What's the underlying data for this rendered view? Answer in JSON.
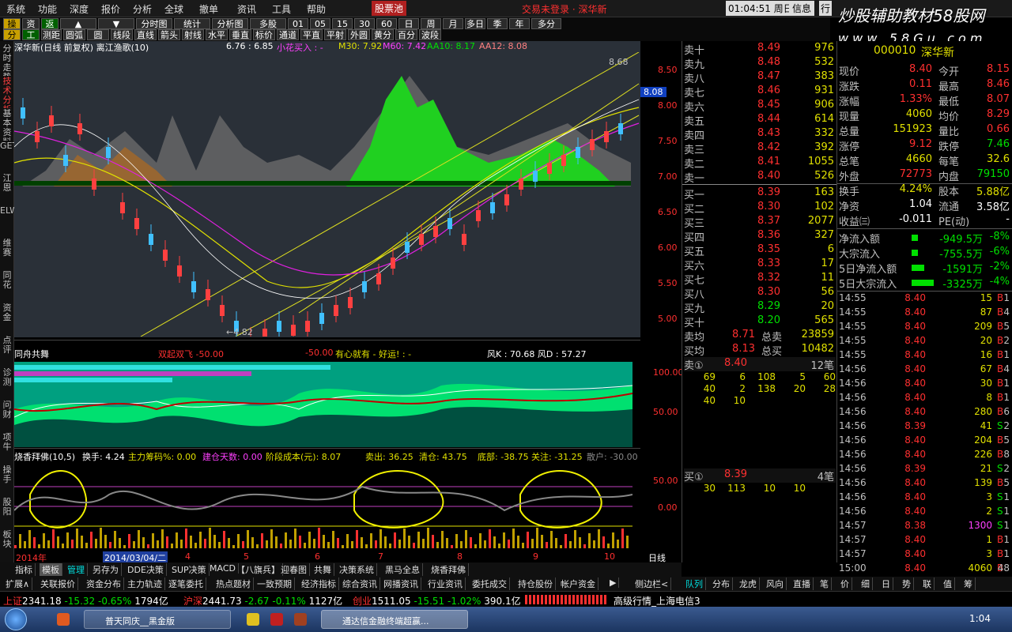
{
  "menu": [
    "系统",
    "功能",
    "深度",
    "报价",
    "分析",
    "全球",
    "撤单",
    "资讯",
    "工具",
    "帮助",
    "股票池"
  ],
  "menu_right": {
    "time": "01:04:51",
    "day": "周日",
    "btn1": "信息",
    "btn2": "行"
  },
  "menu_alert": "交易未登录 · 深华新",
  "watermark": {
    "line1": "炒股辅助教材58股网",
    "line2": "w w w . 5 8 G u . c o m"
  },
  "toolbar": {
    "row1": [
      "操盘",
      "资讯",
      "返回",
      "▲",
      "▼",
      "分时图",
      "统计",
      "分析图",
      "多股",
      "01",
      "05",
      "15",
      "30",
      "60",
      "日",
      "周",
      "月",
      "多日",
      "季",
      "年",
      "多分"
    ],
    "row2": [
      "分析",
      "工具",
      "测距",
      "圆弧",
      "圆",
      "线段",
      "直线",
      "箭头",
      "射线",
      "水平",
      "垂直",
      "标价",
      "通道",
      "平直",
      "平射",
      "外圆",
      "黄分",
      "百分",
      "波段"
    ]
  },
  "left_tabs": [
    "分时走势",
    "技术分析",
    "基本资料",
    "GET",
    "江恩",
    "ELWAVE",
    "维赛",
    "同花",
    "资金",
    "点评",
    "诊测",
    "问财",
    "项牛",
    "操手",
    "股阳",
    "板块"
  ],
  "chart_header": {
    "title": "深华新(日线 前复权) 离江渔歌(10)",
    "vals": "6.76 : 6.85",
    "signal": "小花买入 : -",
    "m30": "M30: 7.92",
    "m60": "M60: 7.42",
    "aa10": "AA10: 8.17",
    "aa12": "AA12: 8.08"
  },
  "axis_main": [
    "8.50",
    "8.00",
    "7.50",
    "7.00",
    "6.50",
    "6.00",
    "5.50",
    "5.00"
  ],
  "price_tag": "8.08",
  "high_label": "8.68",
  "low_label": "←4.82",
  "ind1": {
    "title": "同舟共舞",
    "a": "双起双飞 -50.00",
    "b": "-50.00",
    "c": "有心就有 - 好运! : -",
    "d": "风K : 70.68  风D : 57.27",
    "axis": [
      "100.00",
      "50.00"
    ]
  },
  "ind2": {
    "title": "烧香拜佛(10,5)",
    "a": "换手: 4.24",
    "b": "主力筹码%: 0.00",
    "c": "建仓天数: 0.00",
    "d": "阶段成本(元): 8.07",
    "e": "卖出: 36.25",
    "f": "清仓: 43.75",
    "g": "底部: -38.75",
    "h": "关注: -31.25",
    "i": "散户: -30.00",
    "axis": [
      "50.00",
      "0.00"
    ]
  },
  "xaxis": {
    "year": "2014年",
    "date": "2014/03/04/二",
    "months": [
      "4",
      "5",
      "6",
      "7",
      "8",
      "9",
      "10"
    ],
    "period": "日线"
  },
  "book": {
    "sells": [
      [
        "卖十",
        "8.49",
        "976"
      ],
      [
        "卖九",
        "8.48",
        "532"
      ],
      [
        "卖八",
        "8.47",
        "383"
      ],
      [
        "卖七",
        "8.46",
        "931"
      ],
      [
        "卖六",
        "8.45",
        "906"
      ],
      [
        "卖五",
        "8.44",
        "614"
      ],
      [
        "卖四",
        "8.43",
        "332"
      ],
      [
        "卖三",
        "8.42",
        "392"
      ],
      [
        "卖二",
        "8.41",
        "1055"
      ],
      [
        "卖一",
        "8.40",
        "526"
      ]
    ],
    "buys": [
      [
        "买一",
        "8.39",
        "163"
      ],
      [
        "买二",
        "8.30",
        "102"
      ],
      [
        "买三",
        "8.37",
        "2077"
      ],
      [
        "买四",
        "8.36",
        "327"
      ],
      [
        "买五",
        "8.35",
        "6"
      ],
      [
        "买六",
        "8.33",
        "17"
      ],
      [
        "买七",
        "8.32",
        "11"
      ],
      [
        "买八",
        "8.30",
        "56"
      ],
      [
        "买九",
        "8.29",
        "20"
      ],
      [
        "买十",
        "8.20",
        "565"
      ]
    ],
    "avg_sell": [
      "卖均",
      "8.71",
      "总卖",
      "23859"
    ],
    "avg_buy": [
      "买均",
      "8.13",
      "总买",
      "10482"
    ],
    "sell1": {
      "label": "卖①",
      "price": "8.40",
      "count": "12笔",
      "rows": [
        [
          "69",
          "6",
          "108",
          "5",
          "60"
        ],
        [
          "40",
          "2",
          "138",
          "20",
          "28"
        ],
        [
          "40",
          "10",
          "",
          "",
          ""
        ]
      ]
    },
    "buy1": {
      "label": "买①",
      "price": "8.39",
      "count": "4笔",
      "rows": [
        [
          "30",
          "113",
          "10",
          "10",
          ""
        ]
      ]
    }
  },
  "quote": {
    "code": "000010",
    "name": "深华新",
    "rows": [
      [
        "现价",
        "8.40",
        "今开",
        "8.15"
      ],
      [
        "涨跌",
        "0.11",
        "最高",
        "8.46"
      ],
      [
        "涨幅",
        "1.33%",
        "最低",
        "8.07"
      ],
      [
        "现量",
        "4060",
        "均价",
        "8.29"
      ],
      [
        "总量",
        "151923",
        "量比",
        "0.66"
      ],
      [
        "涨停",
        "9.12",
        "跌停",
        "7.46"
      ],
      [
        "总笔",
        "4660",
        "每笔",
        "32.6"
      ],
      [
        "外盘",
        "72773",
        "内盘",
        "79150"
      ],
      [
        "换手",
        "4.24%",
        "股本",
        "5.88亿"
      ],
      [
        "净资",
        "1.04",
        "流通",
        "3.58亿"
      ],
      [
        "收益㈢",
        "-0.011",
        "PE(动)",
        "-"
      ]
    ],
    "flows": [
      [
        "净流入额",
        "-949.5万",
        "-8%"
      ],
      [
        "大宗流入",
        "-755.5万",
        "-6%"
      ],
      [
        "5日净流入额",
        "-1591万",
        "-2%"
      ],
      [
        "5日大宗流入",
        "-3325万",
        "-4%"
      ]
    ],
    "trades": [
      [
        "14:55",
        "8.40",
        "15",
        "B",
        "1"
      ],
      [
        "14:55",
        "8.40",
        "87",
        "B",
        "4"
      ],
      [
        "14:55",
        "8.40",
        "209",
        "B",
        "5"
      ],
      [
        "14:55",
        "8.40",
        "20",
        "B",
        "2"
      ],
      [
        "14:55",
        "8.40",
        "16",
        "B",
        "1"
      ],
      [
        "14:56",
        "8.40",
        "67",
        "B",
        "4"
      ],
      [
        "14:56",
        "8.40",
        "30",
        "B",
        "1"
      ],
      [
        "14:56",
        "8.40",
        "8",
        "B",
        "1"
      ],
      [
        "14:56",
        "8.40",
        "280",
        "B",
        "6"
      ],
      [
        "14:56",
        "8.39",
        "41",
        "S",
        "2"
      ],
      [
        "14:56",
        "8.40",
        "204",
        "B",
        "5"
      ],
      [
        "14:56",
        "8.40",
        "226",
        "B",
        "8"
      ],
      [
        "14:56",
        "8.39",
        "21",
        "S",
        "2"
      ],
      [
        "14:56",
        "8.40",
        "139",
        "B",
        "5"
      ],
      [
        "14:56",
        "8.40",
        "3",
        "S",
        "1"
      ],
      [
        "14:56",
        "8.40",
        "2",
        "S",
        "1"
      ],
      [
        "14:57",
        "8.38",
        "1300",
        "S",
        "1"
      ],
      [
        "14:57",
        "8.40",
        "1",
        "B",
        "1"
      ],
      [
        "14:57",
        "8.40",
        "3",
        "B",
        "1"
      ],
      [
        "15:00",
        "8.40",
        "4060",
        "B",
        "48"
      ]
    ]
  },
  "bottom_tabs": [
    "指标",
    "模板",
    "管理",
    "另存为",
    "DDE决策",
    "SUP决策",
    "MACD",
    "【八旗兵】",
    "迎春图",
    "共舞",
    "决策系统",
    "黑马全息",
    "烧香拜佛"
  ],
  "bottom_tabs2": [
    "扩展∧",
    "关联报价",
    "资金分布",
    "主力轨迹",
    "逐笔委托",
    "热点题材",
    "一致预期",
    "经济指标",
    "综合资讯",
    "网播资讯",
    "行业资讯",
    "委托成交",
    "持仓股份",
    "帐户资金",
    "▶",
    "侧边栏<"
  ],
  "right_tabs": [
    "队列",
    "分布",
    "龙虎",
    "风向",
    "直播",
    "笔",
    "价",
    "细",
    "日",
    "势",
    "联",
    "值",
    "筹"
  ],
  "status": {
    "sh_name": "上证",
    "sh": "2341.18",
    "sh_chg": "-15.32",
    "sh_pct": "-0.65%",
    "sh_amt": "1794亿",
    "sz_name": "沪深",
    "sz": "2441.73",
    "sz_chg": "-2.67",
    "sz_pct": "-0.11%",
    "sz_amt": "1127亿",
    "cy_name": "创业",
    "cy": "1511.05",
    "cy_chg": "-15.51",
    "cy_pct": "-1.02%",
    "cy_amt": "390.1亿",
    "feed": "高级行情_上海电信3"
  },
  "taskbar": {
    "t1": "普天同庆__黑金版",
    "t2": "通达信金融终端超赢...",
    "clock": "1:04"
  }
}
